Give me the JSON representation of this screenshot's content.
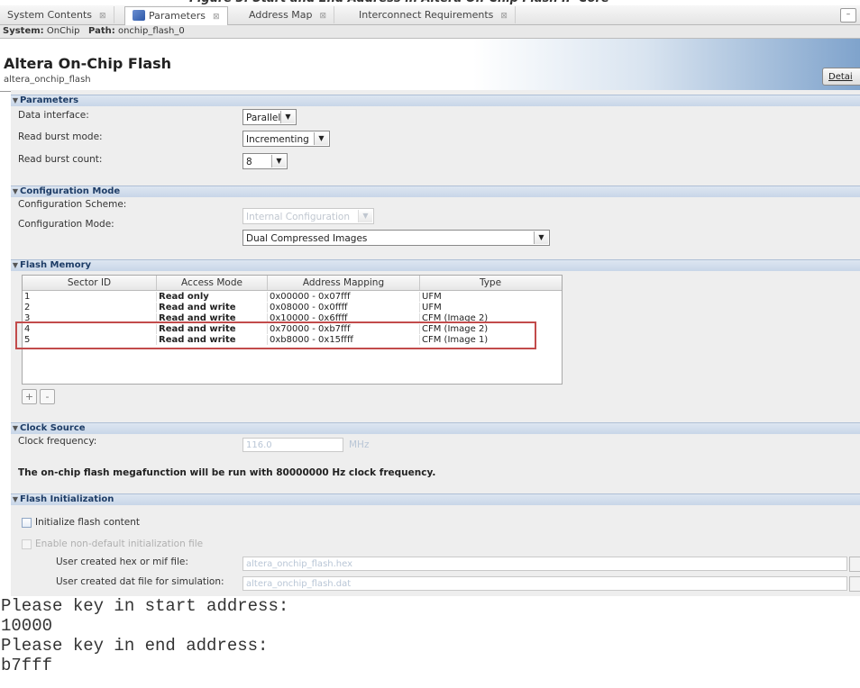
{
  "tabs": [
    {
      "label": "System Contents",
      "active": false
    },
    {
      "label": "Parameters",
      "active": true
    },
    {
      "label": "Address Map",
      "active": false
    },
    {
      "label": "Interconnect Requirements",
      "active": false
    }
  ],
  "path_bar": {
    "system_label": "System:",
    "system_value": "OnChip",
    "path_label": "Path:",
    "path_value": "onchip_flash_0"
  },
  "component": {
    "title": "Altera On-Chip Flash",
    "subtitle": "altera_onchip_flash",
    "details_label": "Detai"
  },
  "parameters": {
    "section_title": "Parameters",
    "data_interface": {
      "label": "Data interface:",
      "value": "Parallel"
    },
    "read_burst_mode": {
      "label": "Read burst mode:",
      "value": "Incrementing"
    },
    "read_burst_count": {
      "label": "Read burst count:",
      "value": "8"
    }
  },
  "configuration_mode": {
    "section_title": "Configuration Mode",
    "scheme": {
      "label": "Configuration Scheme:",
      "value": "Internal Configuration"
    },
    "mode": {
      "label": "Configuration Mode:",
      "value": "Dual Compressed Images"
    }
  },
  "flash_memory": {
    "section_title": "Flash Memory",
    "columns": [
      "Sector ID",
      "Access Mode",
      "Address Mapping",
      "Type"
    ],
    "rows": [
      {
        "id": "1",
        "access": "Read only",
        "mapping": "0x00000 - 0x07fff",
        "type": "UFM"
      },
      {
        "id": "2",
        "access": "Read and write",
        "mapping": "0x08000 - 0x0ffff",
        "type": "UFM"
      },
      {
        "id": "3",
        "access": "Read and write",
        "mapping": "0x10000 - 0x6ffff",
        "type": "CFM (Image 2)"
      },
      {
        "id": "4",
        "access": "Read and write",
        "mapping": "0x70000 - 0xb7fff",
        "type": "CFM (Image 2)"
      },
      {
        "id": "5",
        "access": "Read and write",
        "mapping": "0xb8000 - 0x15ffff",
        "type": "CFM (Image 1)"
      }
    ],
    "add_label": "+",
    "remove_label": "-"
  },
  "clock_source": {
    "section_title": "Clock Source",
    "frequency_label": "Clock frequency:",
    "frequency_value": "116.0",
    "frequency_unit": "MHz",
    "note": "The on-chip flash megafunction will be run with 80000000 Hz clock frequency."
  },
  "flash_initialization": {
    "section_title": "Flash Initialization",
    "initialize_label": "Initialize flash content",
    "enable_nondefault_label": "Enable non-default initialization file",
    "hex_label": "User created hex or mif file:",
    "hex_value": "altera_onchip_flash.hex",
    "dat_label": "User created dat file for simulation:",
    "dat_value": "altera_onchip_flash.dat"
  },
  "console": {
    "lines": [
      "Please key in start address:",
      "10000",
      "Please key in end address:",
      "b7fff"
    ]
  }
}
